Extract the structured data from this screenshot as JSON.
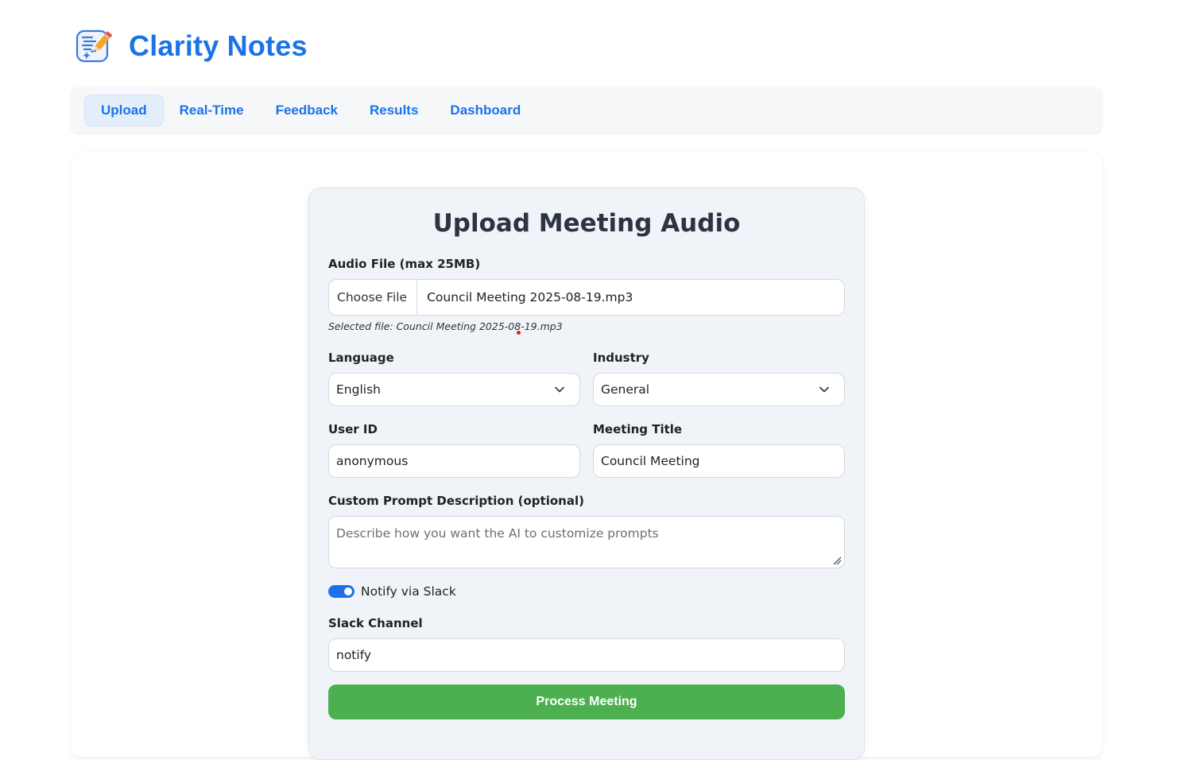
{
  "app": {
    "name": "Clarity Notes",
    "logo_icon": "notes-sparkle-pencil-icon",
    "brand_color": "#1a73e8"
  },
  "nav": {
    "tabs": [
      {
        "label": "Upload",
        "active": true
      },
      {
        "label": "Real-Time",
        "active": false
      },
      {
        "label": "Feedback",
        "active": false
      },
      {
        "label": "Results",
        "active": false
      },
      {
        "label": "Dashboard",
        "active": false
      }
    ]
  },
  "form": {
    "title": "Upload Meeting Audio",
    "audio_file": {
      "label": "Audio File (max 25MB)",
      "button_label": "Choose File",
      "file_name": "Council Meeting 2025-08-19.mp3",
      "selected_text": "Selected file: Council Meeting 2025-08-19.mp3"
    },
    "language": {
      "label": "Language",
      "value": "English"
    },
    "industry": {
      "label": "Industry",
      "value": "General"
    },
    "user_id": {
      "label": "User ID",
      "value": "anonymous"
    },
    "meeting_title": {
      "label": "Meeting Title",
      "value": "Council Meeting"
    },
    "custom_prompt": {
      "label": "Custom Prompt Description (optional)",
      "placeholder": "Describe how you want the AI to customize prompts"
    },
    "notify_slack": {
      "label": "Notify via Slack",
      "checked": true
    },
    "slack_channel": {
      "label": "Slack Channel",
      "value": "notify"
    },
    "submit_label": "Process Meeting",
    "submit_color": "#4caf50"
  }
}
